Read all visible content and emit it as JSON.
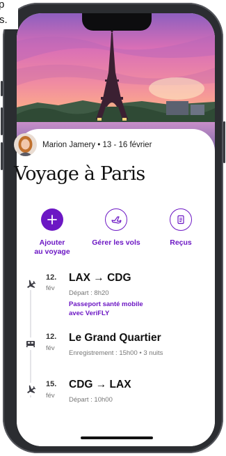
{
  "top_fragment": {
    "line1": "p",
    "line2": "s."
  },
  "trip": {
    "traveler_line": "Marion Jamery • 13 - 16 février",
    "title": "Voyage à Paris"
  },
  "actions": [
    {
      "label_1": "Ajouter",
      "label_2": "au voyage",
      "icon": "plus-icon"
    },
    {
      "label_1": "Gérer les vols",
      "label_2": "",
      "icon": "airplane-icon"
    },
    {
      "label_1": "Reçus",
      "label_2": "",
      "icon": "receipt-icon"
    }
  ],
  "timeline": [
    {
      "icon": "airplane-icon",
      "day": "12.",
      "month": "fév",
      "title": "LAX → CDG",
      "subtitle": "Départ : 8h20",
      "link_1": "Passeport santé mobile",
      "link_2": "avec VeriFLY"
    },
    {
      "icon": "bed-icon",
      "day": "12.",
      "month": "fév",
      "title": "Le Grand Quartier",
      "subtitle": "Enregistrement : 15h00 • 3 nuits"
    },
    {
      "icon": "airplane-icon",
      "day": "15.",
      "month": "fév",
      "title": "CDG → LAX",
      "subtitle": "Départ : 10h00"
    }
  ],
  "colors": {
    "accent": "#6c17c4",
    "frame": "#2b2d31"
  }
}
